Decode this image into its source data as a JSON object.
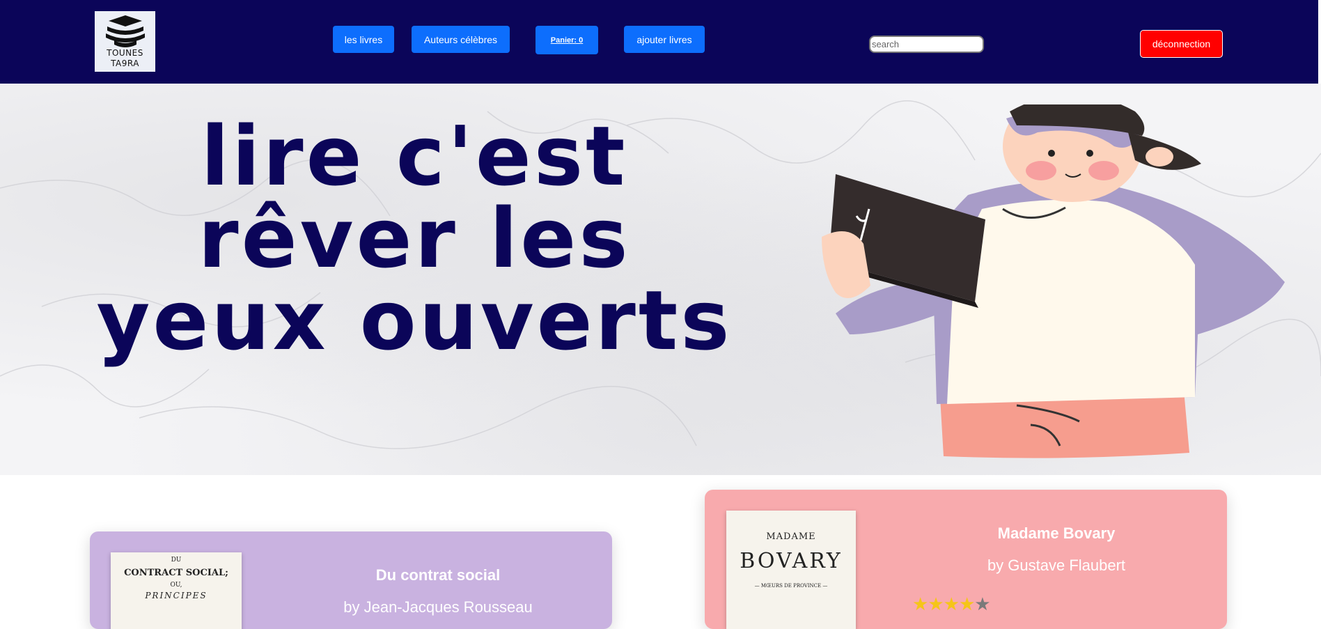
{
  "nav": {
    "logo_line1": "TOUNES",
    "logo_line2": "TA9RA",
    "links": {
      "books": "les livres",
      "authors": "Auteurs célèbres",
      "cart": "Panier: 0",
      "add_books": "ajouter livres"
    },
    "search_placeholder": "search",
    "logout": "déconnection"
  },
  "hero": {
    "line1": "lire c'est",
    "line2": "rêver les",
    "line3": "yeux ouverts"
  },
  "books": [
    {
      "title": "Du contrat social",
      "author": "by Jean-Jacques Rousseau",
      "cover_line1": "DU",
      "cover_line2": "CONTRACT SOCIAL;",
      "cover_line3": "OU,",
      "cover_line4": "PRINCIPES",
      "card_color": "#c9b2e0"
    },
    {
      "title": "Madame Bovary",
      "author": "by Gustave Flaubert",
      "cover_line1": "MADAME",
      "cover_line2": "BOVARY",
      "cover_line3": "— MŒURS DE PROVINCE —",
      "rating": 4,
      "rating_max": 5,
      "card_color": "#f8aaad"
    }
  ],
  "colors": {
    "navbar": "#0b0559",
    "button": "#0d6efd",
    "logout": "#ff0000",
    "hero_text": "#0b0559"
  }
}
